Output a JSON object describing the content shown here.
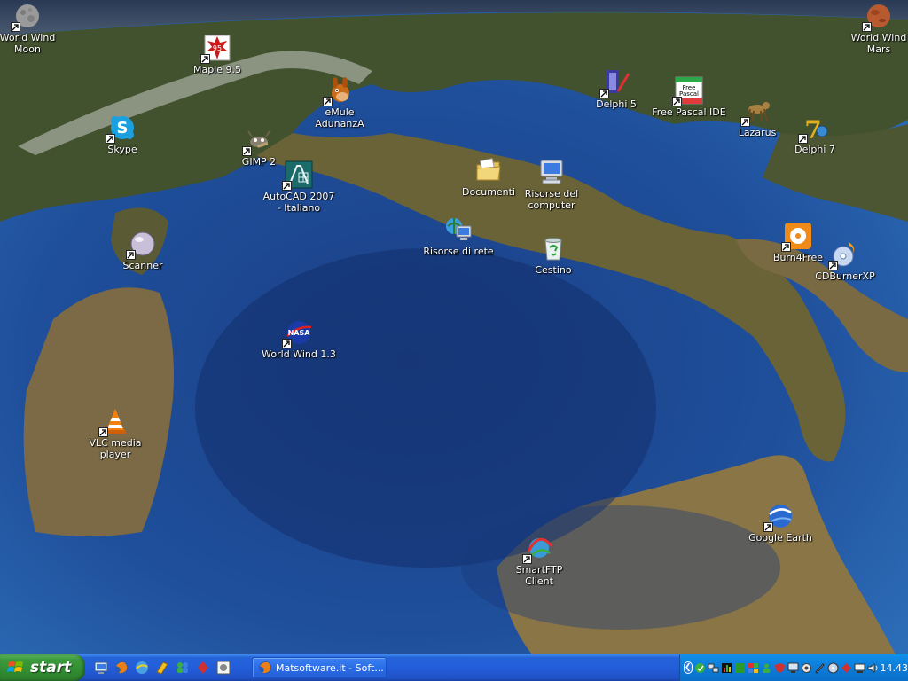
{
  "desktop": {
    "icons": [
      {
        "label": "World Wind Moon",
        "icon": "moon-icon"
      },
      {
        "label": "Maple 9.5",
        "icon": "maple-icon"
      },
      {
        "label": "eMule AdunanzA",
        "icon": "mule-icon"
      },
      {
        "label": "Skype",
        "icon": "skype-icon"
      },
      {
        "label": "GIMP 2",
        "icon": "gimp-icon"
      },
      {
        "label": "AutoCAD 2007 - Italiano",
        "icon": "autocad-icon"
      },
      {
        "label": "Documenti",
        "icon": "documents-folder-icon"
      },
      {
        "label": "Risorse del computer",
        "icon": "my-computer-icon"
      },
      {
        "label": "Delphi 5",
        "icon": "delphi5-icon"
      },
      {
        "label": "Free Pascal IDE",
        "icon": "free-pascal-icon"
      },
      {
        "label": "Lazarus",
        "icon": "lazarus-icon"
      },
      {
        "label": "Delphi 7",
        "icon": "delphi7-icon"
      },
      {
        "label": "World Wind Mars",
        "icon": "mars-icon"
      },
      {
        "label": "Scanner",
        "icon": "scanner-icon"
      },
      {
        "label": "Risorse di rete",
        "icon": "network-places-icon"
      },
      {
        "label": "Cestino",
        "icon": "recycle-bin-icon"
      },
      {
        "label": "Burn4Free",
        "icon": "burn4free-icon"
      },
      {
        "label": "CDBurnerXP",
        "icon": "cdburner-icon"
      },
      {
        "label": "World Wind 1.3",
        "icon": "nasa-icon"
      },
      {
        "label": "VLC media player",
        "icon": "vlc-cone-icon"
      },
      {
        "label": "Google Earth",
        "icon": "google-earth-icon"
      },
      {
        "label": "SmartFTP Client",
        "icon": "smartftp-icon"
      }
    ]
  },
  "taskbar": {
    "start_label": "start",
    "quick_launch": [
      "desktop-icon",
      "firefox-icon",
      "browser-icon",
      "media-icon",
      "messenger-icon",
      "app-icon",
      "screen-icon"
    ],
    "task_button_label": "Matsoftware.it - Soft...",
    "clock": "14.43"
  },
  "colors": {
    "taskbar_blue": "#245edb",
    "start_green": "#3c9a3c",
    "tray_blue": "#0c7fdc"
  }
}
